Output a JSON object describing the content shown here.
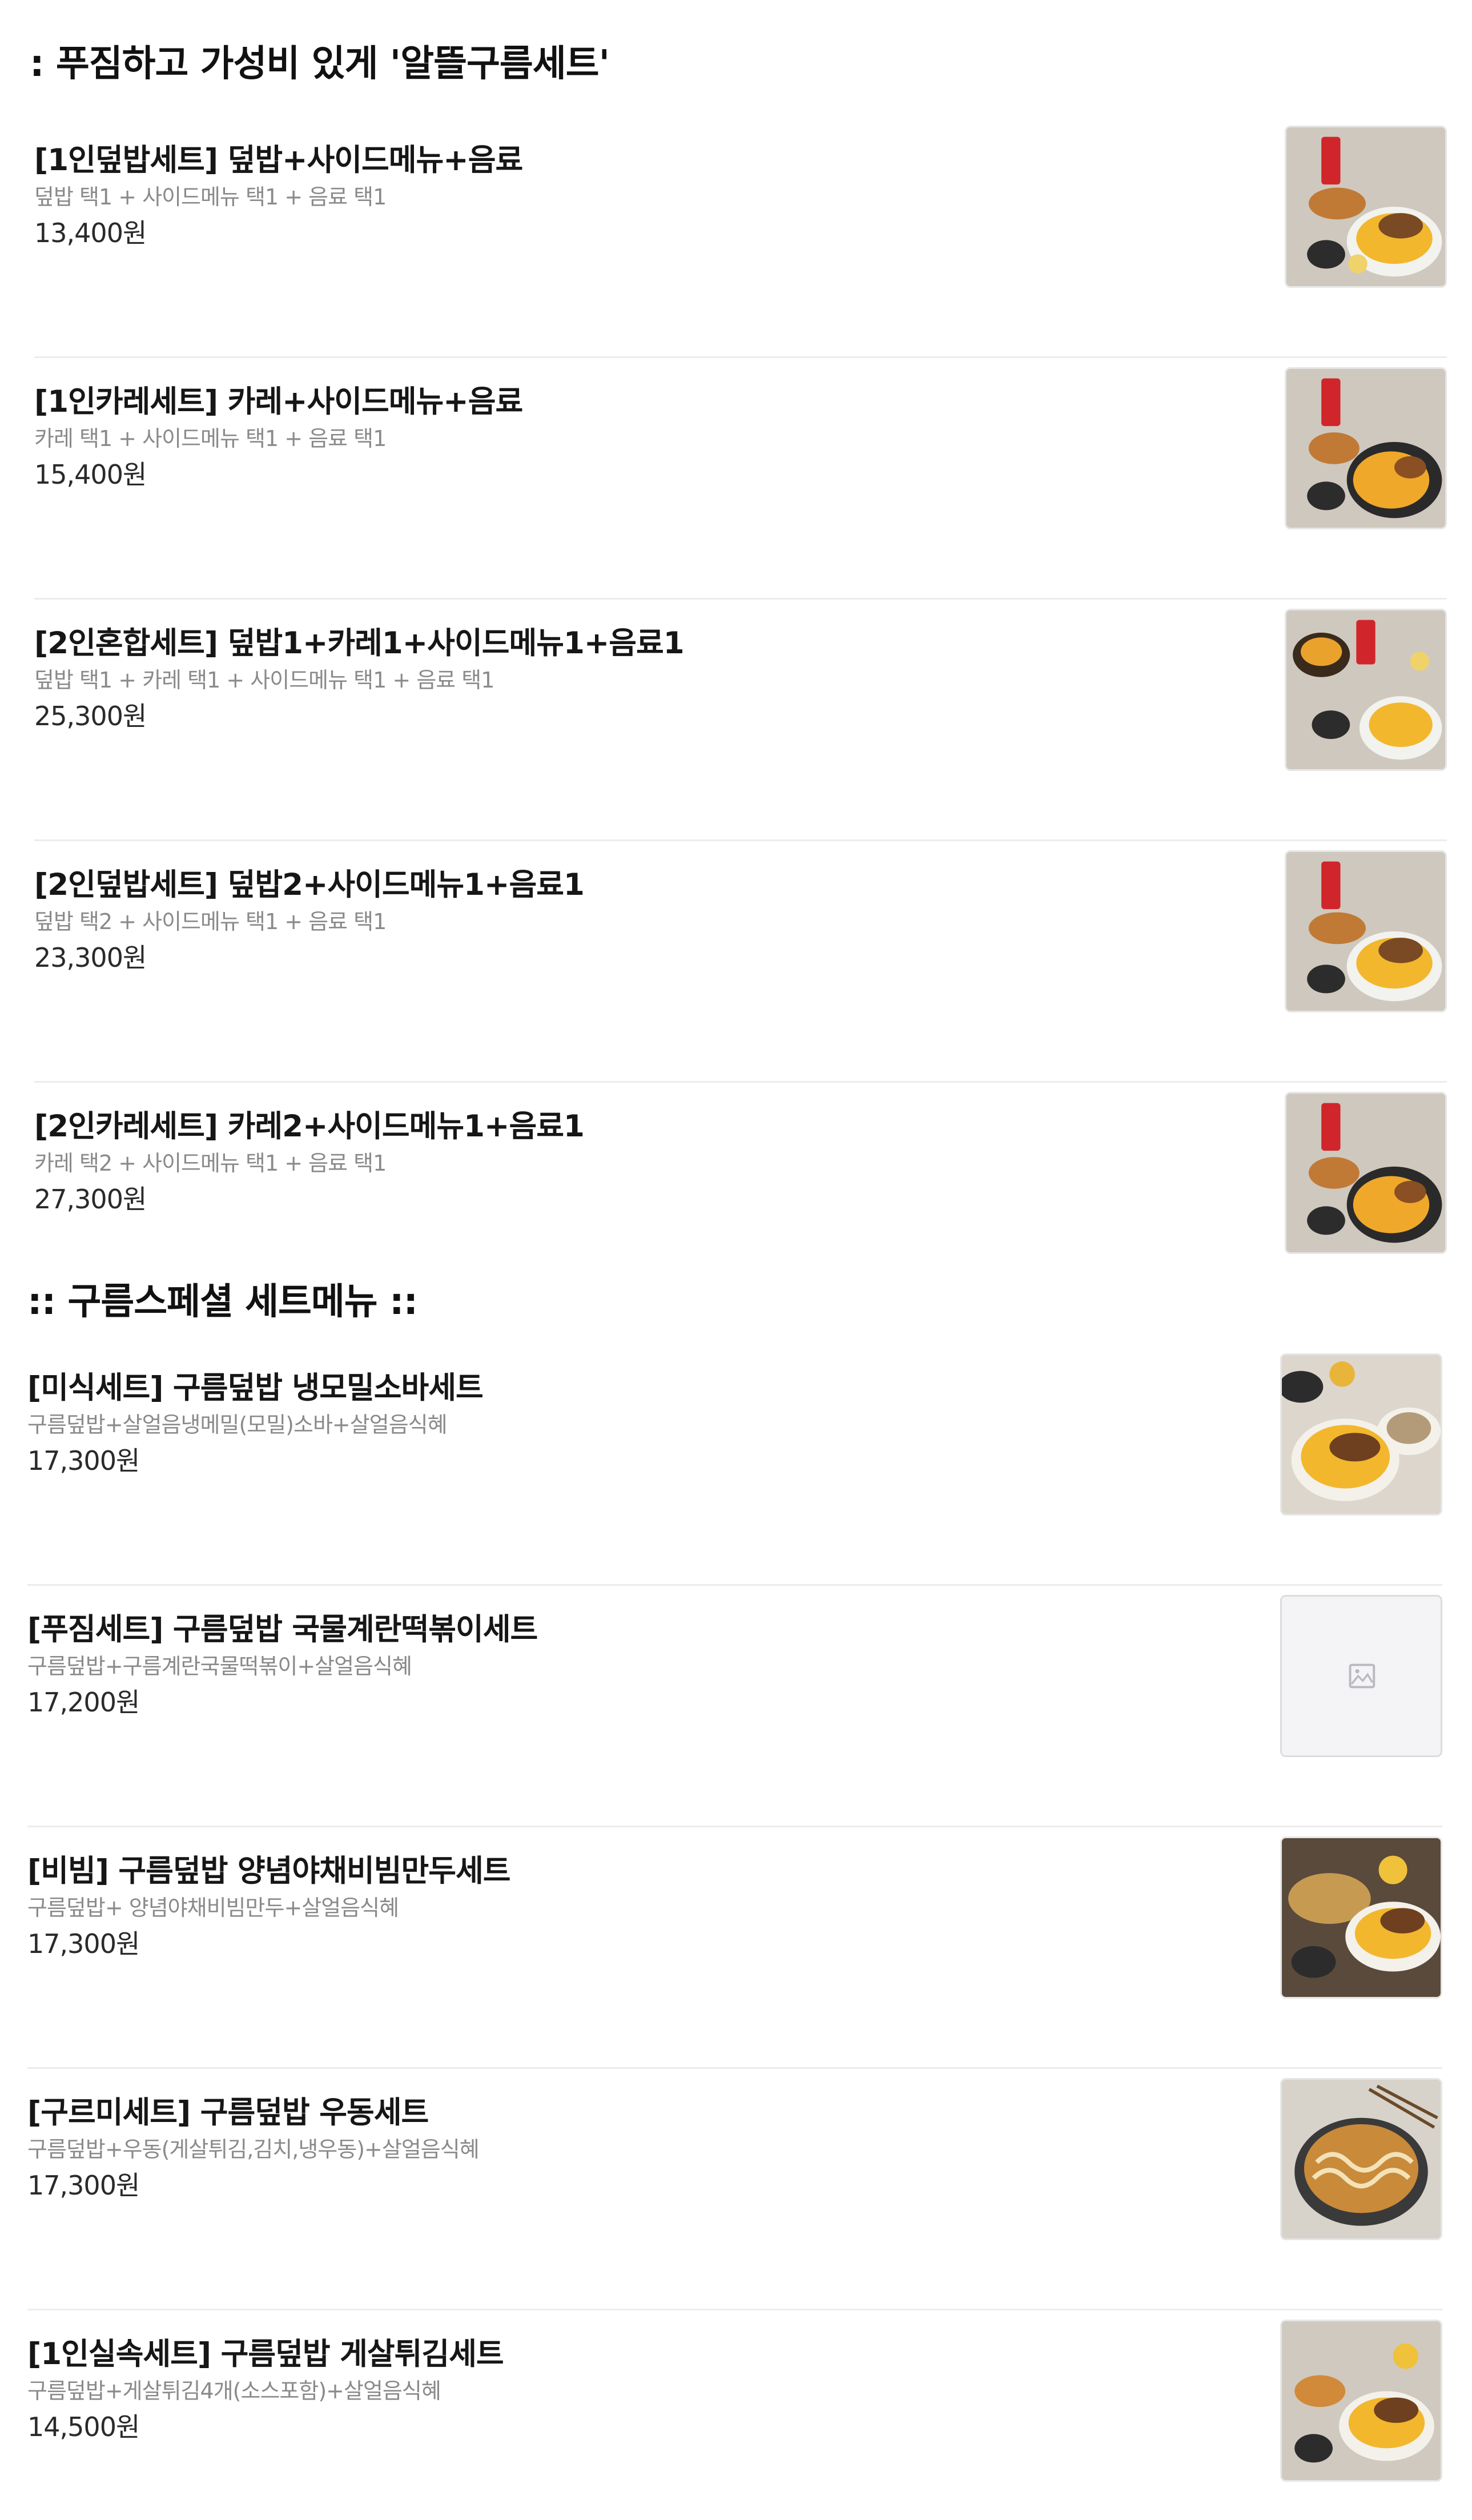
{
  "sections": [
    {
      "title": ": 푸짐하고 가성비 있게 '알뜰구름세트'",
      "items": [
        {
          "name": "[1인덮밥세트] 덮밥+사이드메뉴+음료",
          "desc": "덮밥 택1 + 사이드메뉴 택1 + 음료 택1",
          "price": "13,400원",
          "image": "donburi-set-photo"
        },
        {
          "name": "[1인카레세트] 카레+사이드메뉴+음료",
          "desc": "카레 택1 + 사이드메뉴 택1 + 음료 택1",
          "price": "15,400원",
          "image": "curry-set-photo"
        },
        {
          "name": "[2인혼합세트] 덮밥1+카레1+사이드메뉴1+음료1",
          "desc": "덮밥 택1 + 카레 택1 + 사이드메뉴 택1 + 음료 택1",
          "price": "25,300원",
          "image": "mixed-set-photo"
        },
        {
          "name": "[2인덮밥세트] 덮밥2+사이드메뉴1+음료1",
          "desc": "덮밥 택2 + 사이드메뉴 택1 + 음료 택1",
          "price": "23,300원",
          "image": "donburi-set-photo"
        },
        {
          "name": "[2인카레세트] 카레2+사이드메뉴1+음료1",
          "desc": "카레 택2 + 사이드메뉴 택1 + 음료 택1",
          "price": "27,300원",
          "image": "curry-set-photo"
        }
      ]
    },
    {
      "title": ":: 구름스페셜 세트메뉴 ::",
      "items": [
        {
          "name": "[미식세트] 구름덮밥 냉모밀소바세트",
          "desc": "구름덮밥+살얼음냉메밀(모밀)소바+살얼음식혜",
          "price": "17,300원",
          "image": "soba-set-photo"
        },
        {
          "name": "[푸짐세트] 구름덮밥 국물계란떡볶이세트",
          "desc": "구름덮밥+구름계란국물떡볶이+살얼음식혜",
          "price": "17,200원",
          "image": "image-placeholder-icon"
        },
        {
          "name": "[비빔] 구름덮밥 양념야채비빔만두세트",
          "desc": "구름덮밥+ 양념야채비빔만두+살얼음식혜",
          "price": "17,300원",
          "image": "mandu-set-photo"
        },
        {
          "name": "[구르미세트] 구름덮밥 우동세트",
          "desc": "구름덮밥+우동(게살튀김,김치,냉우동)+살얼음식혜",
          "price": "17,300원",
          "image": "udon-photo"
        },
        {
          "name": "[1인실속세트] 구름덮밥 게살튀김세트",
          "desc": "구름덮밥+게살튀김4개(소스포함)+살얼음식혜",
          "price": "14,500원",
          "image": "crab-fry-set-photo"
        }
      ]
    }
  ]
}
